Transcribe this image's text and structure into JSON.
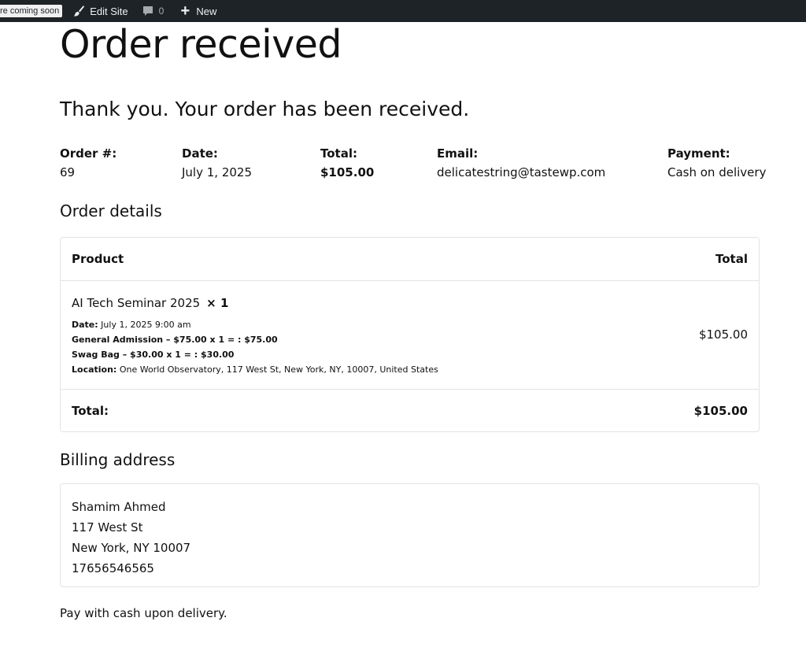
{
  "admin_bar": {
    "badge": "re coming soon",
    "edit_site": "Edit Site",
    "comments_count": "0",
    "new_label": "New"
  },
  "page": {
    "title": "Order received",
    "thank_you": "Thank you. Your order has been received."
  },
  "overview": {
    "order_label": "Order #:",
    "order_value": "69",
    "date_label": "Date:",
    "date_value": "July 1, 2025",
    "total_label": "Total:",
    "total_value": "$105.00",
    "email_label": "Email:",
    "email_value": "delicatestring@tastewp.com",
    "payment_label": "Payment:",
    "payment_value": "Cash on delivery"
  },
  "order_details": {
    "heading": "Order details",
    "col_product": "Product",
    "col_total": "Total",
    "item": {
      "name": "AI Tech Seminar 2025",
      "qty": "× 1",
      "total": "$105.00",
      "meta": [
        {
          "label": "Date:",
          "value": "July 1, 2025 9:00 am"
        },
        {
          "label": "General Admission – $75.00 x 1 = : $75.00",
          "value": ""
        },
        {
          "label": "Swag Bag – $30.00 x 1 = : $30.00",
          "value": ""
        },
        {
          "label": "Location:",
          "value": "One World Observatory, 117 West St, New York, NY, 10007, United States"
        }
      ]
    },
    "footer_label": "Total:",
    "footer_value": "$105.00"
  },
  "billing": {
    "heading": "Billing address",
    "lines": [
      "Shamim Ahmed",
      "117 West St",
      "New York, NY 10007",
      "17656546565"
    ]
  },
  "payment_note": "Pay with cash upon delivery."
}
